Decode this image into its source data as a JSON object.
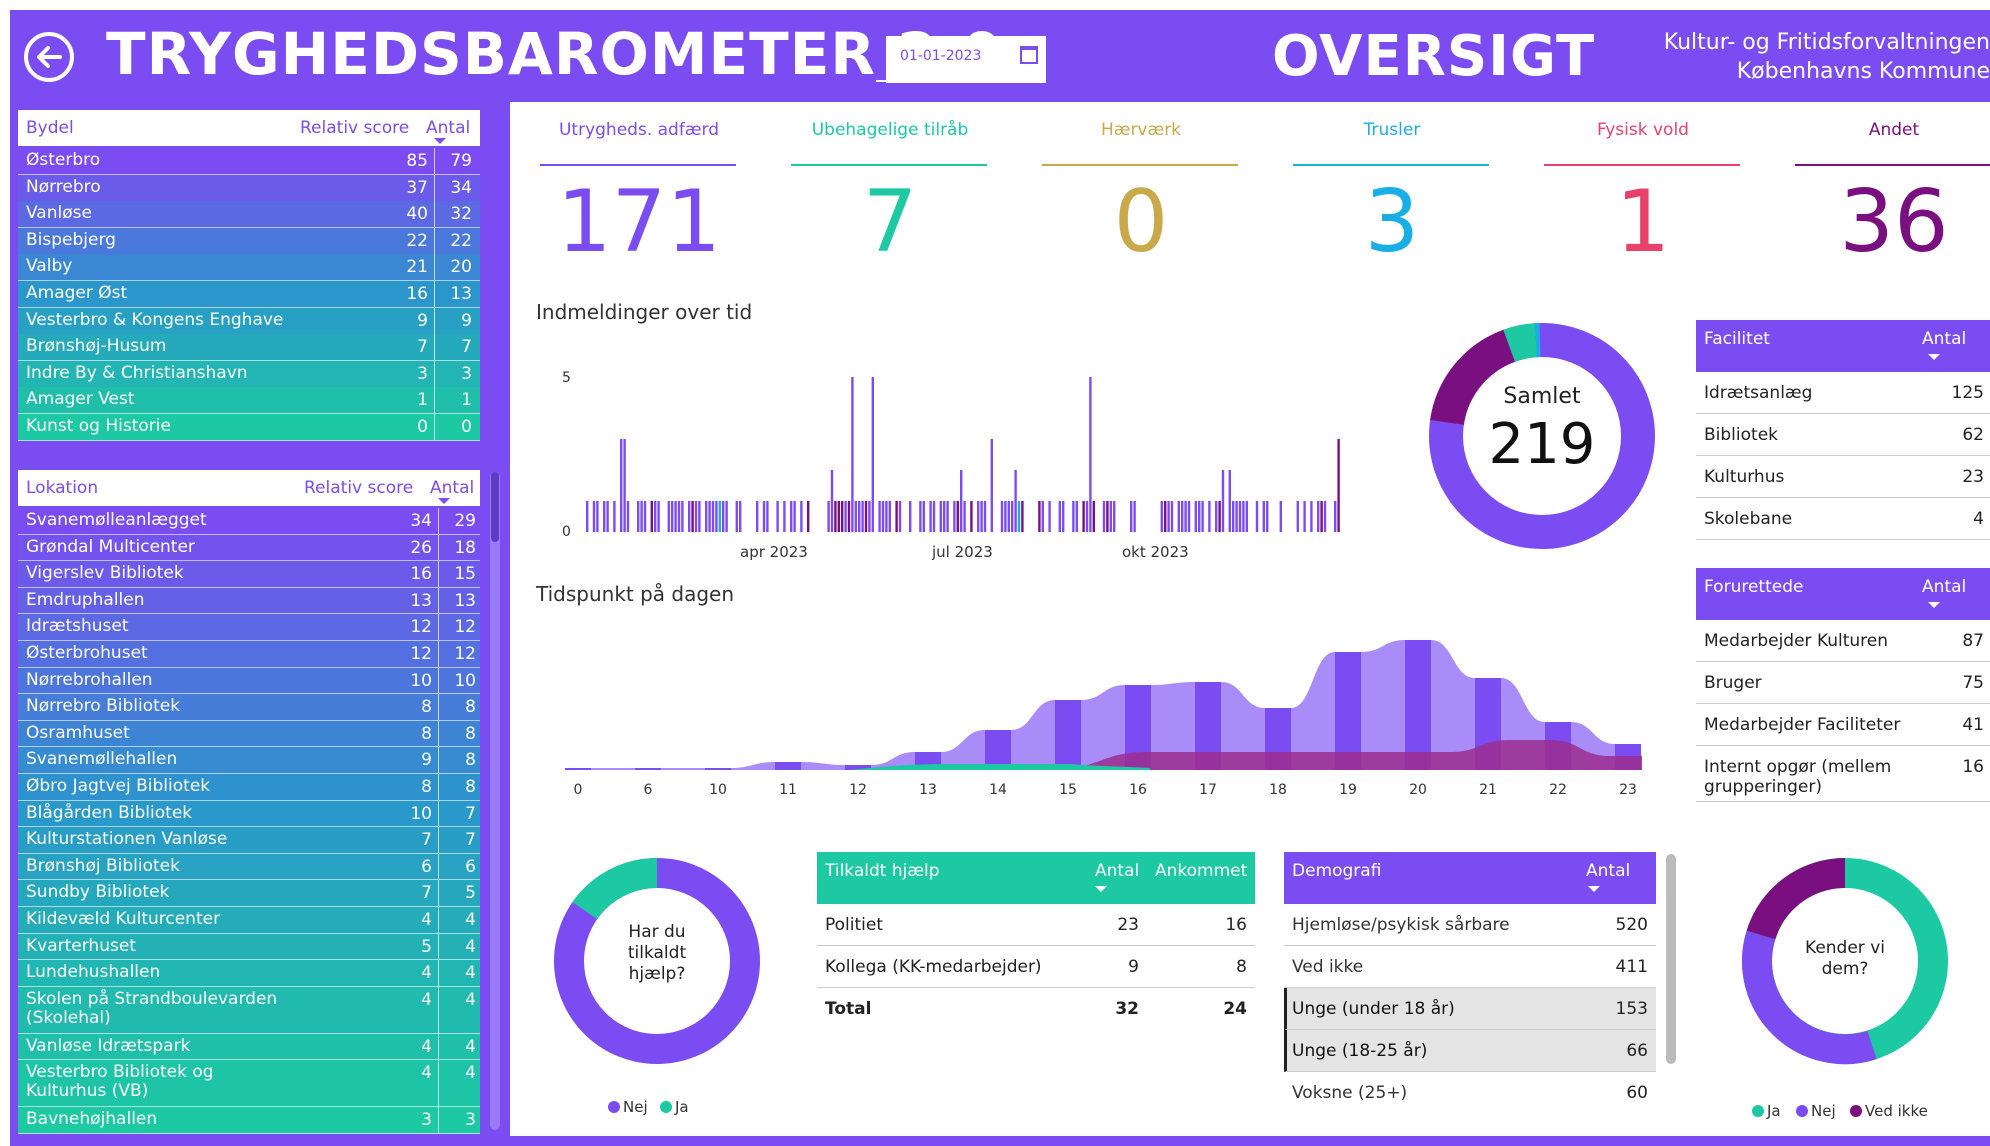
{
  "header": {
    "title": "TRYGHEDSBAROMETER 2.0",
    "date_value": "01-01-2023",
    "page": "OVERSIGT",
    "org_line1": "Kultur- og Fritidsforvaltningen",
    "org_line2": "Københavns Kommune"
  },
  "colors": {
    "purple": "#7B4CF2",
    "teal": "#1CC9A2",
    "gold": "#C9A94A",
    "blue": "#19AEE6",
    "red": "#E8416A",
    "darkpurple": "#7A107F"
  },
  "bydel": {
    "headers": {
      "name": "Bydel",
      "score": "Relativ score",
      "count": "Antal"
    },
    "rows": [
      {
        "name": "Østerbro",
        "score": "85",
        "count": "79"
      },
      {
        "name": "Nørrebro",
        "score": "37",
        "count": "34"
      },
      {
        "name": "Vanløse",
        "score": "40",
        "count": "32"
      },
      {
        "name": "Bispebjerg",
        "score": "22",
        "count": "22"
      },
      {
        "name": "Valby",
        "score": "21",
        "count": "20"
      },
      {
        "name": "Amager Øst",
        "score": "16",
        "count": "13"
      },
      {
        "name": "Vesterbro & Kongens Enghave",
        "score": "9",
        "count": "9"
      },
      {
        "name": "Brønshøj-Husum",
        "score": "7",
        "count": "7"
      },
      {
        "name": "Indre By & Christianshavn",
        "score": "3",
        "count": "3"
      },
      {
        "name": "Amager Vest",
        "score": "1",
        "count": "1"
      },
      {
        "name": "Kunst og Historie",
        "score": "0",
        "count": "0"
      }
    ]
  },
  "lokation": {
    "headers": {
      "name": "Lokation",
      "score": "Relativ score",
      "count": "Antal"
    },
    "rows": [
      {
        "name": "Svanemølleanlægget",
        "score": "34",
        "count": "29"
      },
      {
        "name": "Grøndal Multicenter",
        "score": "26",
        "count": "18"
      },
      {
        "name": "Vigerslev Bibliotek",
        "score": "16",
        "count": "15"
      },
      {
        "name": "Emdruphallen",
        "score": "13",
        "count": "13"
      },
      {
        "name": "Idrætshuset",
        "score": "12",
        "count": "12"
      },
      {
        "name": "Østerbrohuset",
        "score": "12",
        "count": "12"
      },
      {
        "name": "Nørrebrohallen",
        "score": "10",
        "count": "10"
      },
      {
        "name": "Nørrebro Bibliotek",
        "score": "8",
        "count": "8"
      },
      {
        "name": "Osramhuset",
        "score": "8",
        "count": "8"
      },
      {
        "name": "Svanemøllehallen",
        "score": "9",
        "count": "8"
      },
      {
        "name": "Øbro Jagtvej Bibliotek",
        "score": "8",
        "count": "8"
      },
      {
        "name": "Blågården Bibliotek",
        "score": "10",
        "count": "7"
      },
      {
        "name": "Kulturstationen Vanløse",
        "score": "7",
        "count": "7"
      },
      {
        "name": "Brønshøj Bibliotek",
        "score": "6",
        "count": "6"
      },
      {
        "name": "Sundby Bibliotek",
        "score": "7",
        "count": "5"
      },
      {
        "name": "Kildevæld Kulturcenter",
        "score": "4",
        "count": "4"
      },
      {
        "name": "Kvarterhuset",
        "score": "5",
        "count": "4"
      },
      {
        "name": "Lundehushallen",
        "score": "4",
        "count": "4"
      },
      {
        "name": "Skolen på Strandboulevarden (Skolehal)",
        "score": "4",
        "count": "4"
      },
      {
        "name": "Vanløse Idrætspark",
        "score": "4",
        "count": "4"
      },
      {
        "name": "Vesterbro Bibliotek og Kulturhus (VB)",
        "score": "4",
        "count": "4"
      },
      {
        "name": "Bavnehøjhallen",
        "score": "3",
        "count": "3"
      }
    ]
  },
  "kpis": [
    {
      "label": "Utrygheds. adfærd",
      "value": "171",
      "color": "#7B4CF2"
    },
    {
      "label": "Ubehagelige tilråb",
      "value": "7",
      "color": "#1CC9A2"
    },
    {
      "label": "Hærværk",
      "value": "0",
      "color": "#C9A94A"
    },
    {
      "label": "Trusler",
      "value": "3",
      "color": "#19AEE6"
    },
    {
      "label": "Fysisk vold",
      "value": "1",
      "color": "#E8416A"
    },
    {
      "label": "Andet",
      "value": "36",
      "color": "#7A107F"
    }
  ],
  "timeline": {
    "title": "Indmeldinger over tid",
    "y_ticks": [
      "5",
      "0"
    ],
    "x_ticks": [
      "apr 2023",
      "jul 2023",
      "okt 2023"
    ]
  },
  "donut_total": {
    "label": "Samlet",
    "value": "219"
  },
  "timeofday": {
    "title": "Tidspunkt på dagen",
    "x_ticks": [
      "0",
      "6",
      "10",
      "11",
      "12",
      "13",
      "14",
      "15",
      "16",
      "17",
      "18",
      "19",
      "20",
      "21",
      "22",
      "23"
    ]
  },
  "facilitet": {
    "headers": {
      "name": "Facilitet",
      "count": "Antal"
    },
    "rows": [
      {
        "name": "Idrætsanlæg",
        "count": "125"
      },
      {
        "name": "Bibliotek",
        "count": "62"
      },
      {
        "name": "Kulturhus",
        "count": "23"
      },
      {
        "name": "Skolebane",
        "count": "4"
      }
    ]
  },
  "forurettede": {
    "headers": {
      "name": "Forurettede",
      "count": "Antal"
    },
    "rows": [
      {
        "name": "Medarbejder Kulturen",
        "count": "87"
      },
      {
        "name": "Bruger",
        "count": "75"
      },
      {
        "name": "Medarbejder Faciliteter",
        "count": "41"
      },
      {
        "name": "Internt opgør (mellem grupperinger)",
        "count": "16"
      }
    ]
  },
  "help_donut": {
    "label": "Har du tilkaldt hjælp?",
    "legend": [
      "Nej",
      "Ja"
    ]
  },
  "tilkaldt": {
    "headers": {
      "name": "Tilkaldt hjælp",
      "count": "Antal",
      "arrived": "Ankommet"
    },
    "rows": [
      {
        "name": "Politiet",
        "count": "23",
        "arrived": "16"
      },
      {
        "name": "Kollega (KK-medarbejder)",
        "count": "9",
        "arrived": "8"
      }
    ],
    "total": {
      "name": "Total",
      "count": "32",
      "arrived": "24"
    }
  },
  "demografi": {
    "headers": {
      "name": "Demografi",
      "count": "Antal"
    },
    "rows": [
      {
        "name": "Hjemløse/psykisk sårbare",
        "count": "520"
      },
      {
        "name": "Ved ikke",
        "count": "411"
      },
      {
        "name": "Unge (under 18 år)",
        "count": "153"
      },
      {
        "name": "Unge (18-25 år)",
        "count": "66"
      },
      {
        "name": "Voksne (25+)",
        "count": "60"
      }
    ]
  },
  "know_donut": {
    "label": "Kender vi dem?",
    "legend": [
      "Ja",
      "Nej",
      "Ved ikke"
    ]
  }
}
